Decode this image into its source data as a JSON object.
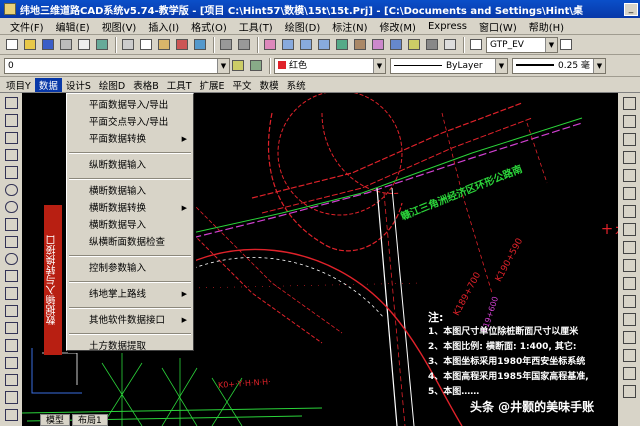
{
  "window": {
    "title": "纬地三维道路CAD系统v5.74-教学版 - [项目 C:\\Hint57\\数模\\15t\\15t.Prj] - [C:\\Documents and Settings\\Hint\\桌"
  },
  "menubar": {
    "items": [
      "文件(F)",
      "编辑(E)",
      "视图(V)",
      "插入(I)",
      "格式(O)",
      "工具(T)",
      "绘图(D)",
      "标注(N)",
      "修改(M)",
      "Express",
      "窗口(W)",
      "帮助(H)"
    ]
  },
  "toolbar2": {
    "layer_value": "0",
    "color_value": "红色",
    "linetype_value": "ByLayer",
    "lineweight_value": "0.25 毫"
  },
  "toolbar1": {
    "style_value": "GTP_EV"
  },
  "tabrow": {
    "tabs": [
      "项目Y",
      "数据",
      "设计S",
      "绘图D",
      "表格B",
      "工具T",
      "扩展E",
      "平文",
      "数模",
      "系统"
    ]
  },
  "dropdown": {
    "items": [
      {
        "label": "平面数据导入/导出",
        "submenu": false
      },
      {
        "label": "平面交点导入/导出",
        "submenu": false
      },
      {
        "label": "平面数据转换",
        "submenu": true
      },
      {
        "sep": true
      },
      {
        "label": "纵断数据输入",
        "submenu": false
      },
      {
        "sep": true
      },
      {
        "label": "横断数据输入",
        "submenu": false
      },
      {
        "label": "横断数据转换",
        "submenu": true
      },
      {
        "label": "横断数据导入",
        "submenu": false
      },
      {
        "label": "纵横断面数据检查",
        "submenu": false
      },
      {
        "sep": true
      },
      {
        "label": "控制参数输入",
        "submenu": false
      },
      {
        "sep": true
      },
      {
        "label": "纬地掌上路线",
        "submenu": true
      },
      {
        "sep": true
      },
      {
        "label": "其他软件数据接口",
        "submenu": true
      },
      {
        "sep": true
      },
      {
        "label": "土方数据提取",
        "submenu": false
      }
    ]
  },
  "banner": {
    "text": "数据输入与转换接口"
  },
  "canvas": {
    "road_label": "赣江三角洲经济区环形公路南",
    "label_br": "十 九",
    "label_km": "K190+590",
    "label_km2": "K189+700",
    "label_red1": "K0+·Y·H·N·H·",
    "label_mag": "K19+600",
    "notes": {
      "title": "注:",
      "lines": [
        "1、本图尺寸单位除桩断面尺寸以厘米",
        "2、本图比例: 横断面: 1:400, 其它:",
        "3、本图坐标采用1980年西安坐标系统",
        "4、本图高程采用1985年国家高程基准,",
        "5、本图……"
      ]
    }
  },
  "bottom_tabs": [
    "模型",
    "布局1"
  ],
  "watermark": "头条 @井颢的美味手账",
  "colors": {
    "titlebar": "#0838a8",
    "chrome": "#d8d4c8",
    "canvas": "#000000",
    "banner": "#b81f12",
    "road_red": "#e0222a",
    "road_green": "#2bd43a",
    "road_magenta": "#d040d0"
  }
}
